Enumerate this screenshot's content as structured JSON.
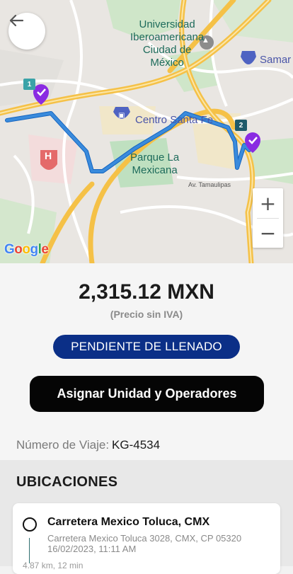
{
  "map": {
    "labels": {
      "university": "Universidad\nIberoamericana\nCiudad de\nMéxico",
      "mall": "Centro Santa Fe",
      "park": "Parque La\nMexicana",
      "street": "Av. Tamaulipas",
      "store": "Samar"
    },
    "markers": [
      {
        "badge": "1",
        "badge_color": "#3aa3a8"
      },
      {
        "badge": "2",
        "badge_color": "#1e5a6a"
      }
    ],
    "zoom_in_label": "+",
    "zoom_out_label": "−",
    "attribution": "Google",
    "colors": {
      "route": "#3a8bdc",
      "marker": "#8a2be2",
      "road": "#f5c147"
    }
  },
  "price": {
    "amount": "2,315.12 MXN",
    "note": "(Precio sin IVA)"
  },
  "status_badge": "PENDIENTE DE LLENADO",
  "assign_button": "Asignar Unidad y Operadores",
  "trip": {
    "label": "Número de Viaje:",
    "value": "KG-4534"
  },
  "locations": {
    "title": "UBICACIONES",
    "items": [
      {
        "title": "Carretera Mexico Toluca, CMX",
        "address": "Carretera Mexico Toluca 3028, CMX, CP 05320",
        "datetime": "16/02/2023, 11:11 AM",
        "distance": "4.87 km, 12 min"
      }
    ]
  }
}
